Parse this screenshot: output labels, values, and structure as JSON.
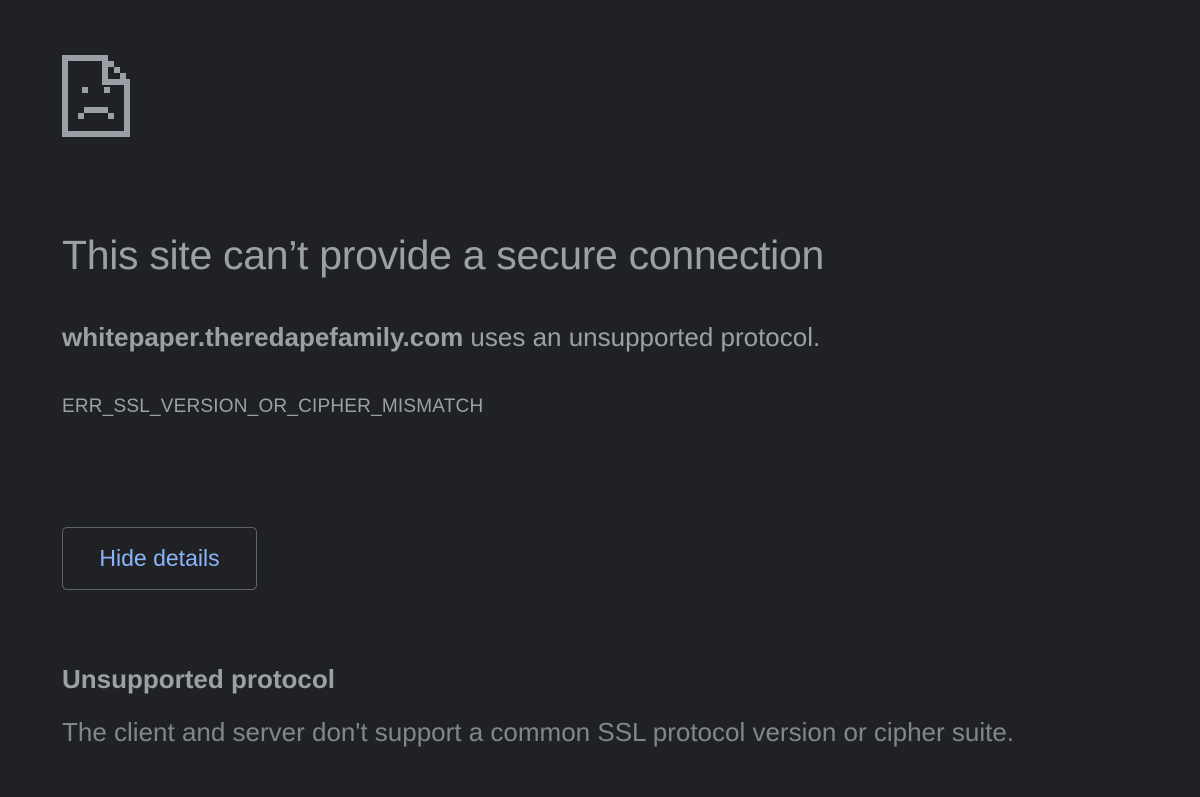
{
  "icon": "sad-page-icon",
  "colors": {
    "background": "#202124",
    "text": "#9aa0a6",
    "link": "#8ab4f8",
    "border": "#5f6368"
  },
  "main": {
    "heading": "This site can’t provide a secure connection",
    "summary_host": "whitepaper.theredapefamily.com",
    "summary_rest": " uses an unsupported protocol.",
    "error_code": "ERR_SSL_VERSION_OR_CIPHER_MISMATCH"
  },
  "button": {
    "label": "Hide details"
  },
  "details": {
    "title": "Unsupported protocol",
    "text": "The client and server don't support a common SSL protocol version or cipher suite."
  }
}
